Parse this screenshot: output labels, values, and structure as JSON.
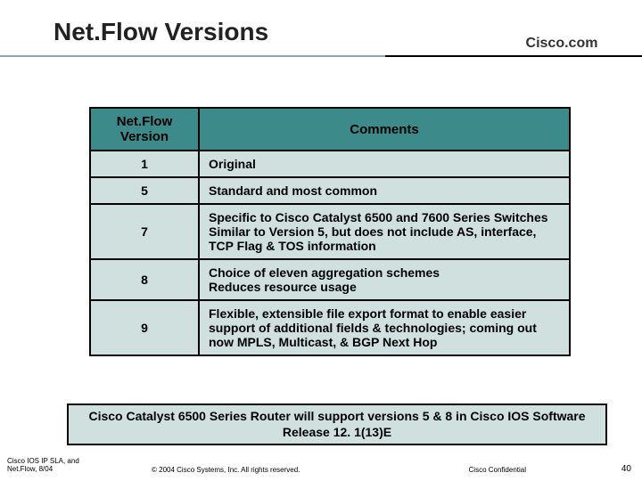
{
  "title": "Net.Flow Versions",
  "brand": "Cisco.com",
  "table": {
    "headers": {
      "version": "Net.Flow Version",
      "comments": "Comments"
    },
    "rows": [
      {
        "version": "1",
        "comment": "Original"
      },
      {
        "version": "5",
        "comment": "Standard and most common"
      },
      {
        "version": "7",
        "comment": "Specific to Cisco Catalyst 6500 and 7600 Series Switches\nSimilar to Version 5, but does not include AS, interface, TCP Flag & TOS information"
      },
      {
        "version": "8",
        "comment": "Choice of eleven aggregation schemes\nReduces resource usage"
      },
      {
        "version": "9",
        "comment": "Flexible, extensible file export format to enable easier support of additional fields & technologies; coming out now MPLS, Multicast, & BGP Next Hop"
      }
    ]
  },
  "callout": "Cisco Catalyst 6500 Series Router will support versions 5 & 8 in Cisco IOS Software Release 12. 1(13)E",
  "footer": {
    "left_line1": "Cisco IOS IP SLA, and",
    "left_line2": "Net.Flow, 8/04",
    "copyright": "© 2004 Cisco Systems, Inc. All rights reserved.",
    "confidential": "Cisco Confidential",
    "page": "40"
  },
  "chart_data": {
    "type": "table",
    "title": "Net.Flow Versions",
    "columns": [
      "Net.Flow Version",
      "Comments"
    ],
    "rows": [
      [
        "1",
        "Original"
      ],
      [
        "5",
        "Standard and most common"
      ],
      [
        "7",
        "Specific to Cisco Catalyst 6500 and 7600 Series Switches; Similar to Version 5, but does not include AS, interface, TCP Flag & TOS information"
      ],
      [
        "8",
        "Choice of eleven aggregation schemes; Reduces resource usage"
      ],
      [
        "9",
        "Flexible, extensible file export format to enable easier support of additional fields & technologies; coming out now MPLS, Multicast, & BGP Next Hop"
      ]
    ]
  }
}
